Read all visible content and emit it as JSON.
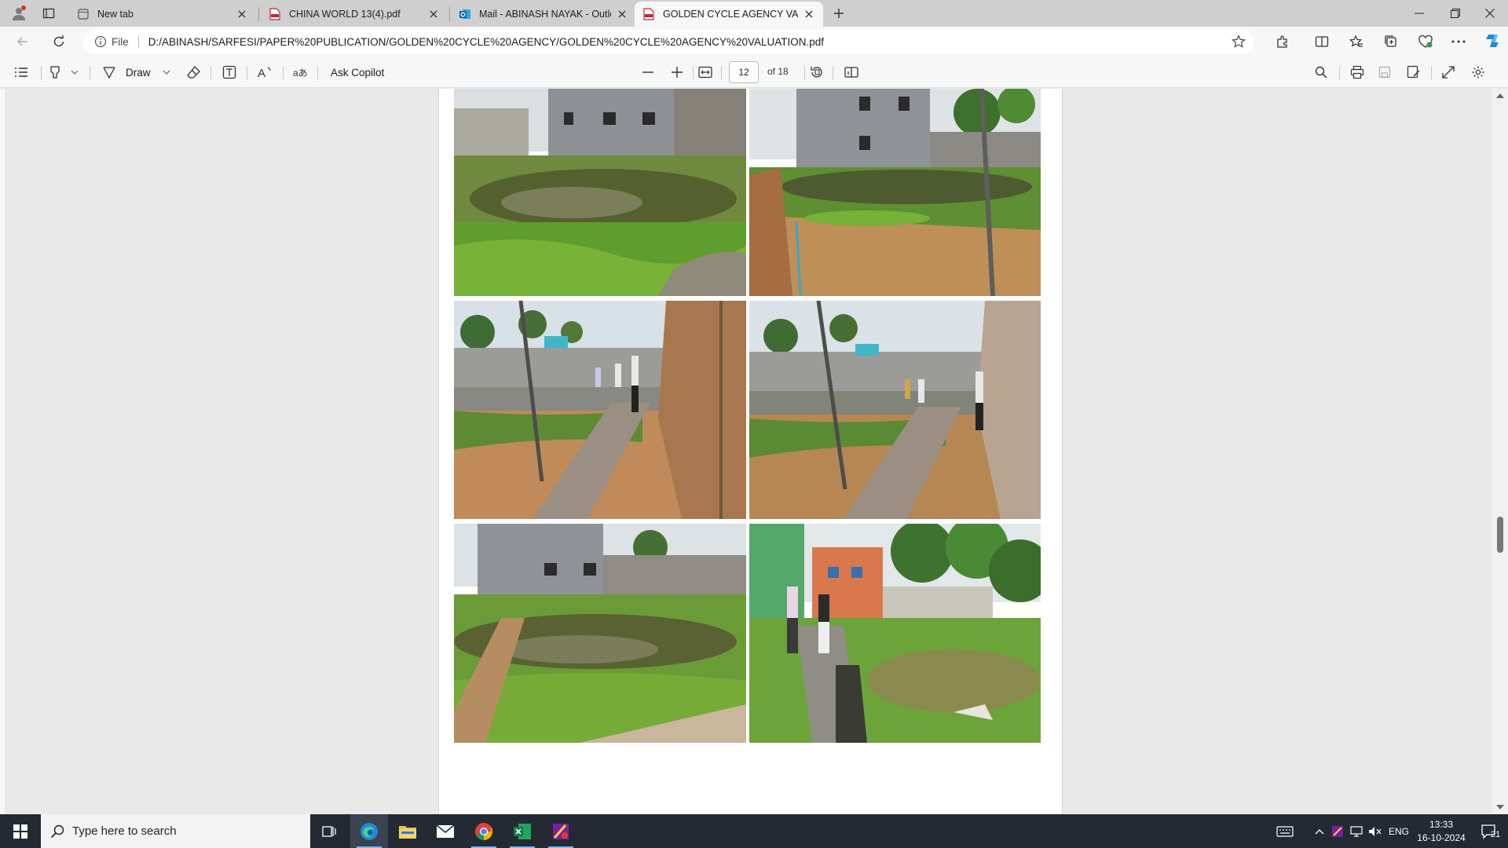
{
  "browser": {
    "tabs": [
      {
        "title": "New tab",
        "icon": "newtab-page-icon",
        "active": false
      },
      {
        "title": "CHINA WORLD 13(4).pdf",
        "icon": "pdf-file-icon",
        "active": false
      },
      {
        "title": "Mail - ABINASH NAYAK - Outlook",
        "icon": "outlook-icon",
        "active": false
      },
      {
        "title": "GOLDEN CYCLE AGENCY VALUATI",
        "icon": "pdf-file-icon",
        "active": true
      }
    ],
    "address": {
      "scheme": "File",
      "url": "D:/ABINASH/SARFESI/PAPER%20PUBLICATION/GOLDEN%20CYCLE%20AGENCY/GOLDEN%20CYCLE%20AGENCY%20VALUATION.pdf"
    }
  },
  "pdf_toolbar": {
    "draw_label": "Draw",
    "copilot_label": "Ask Copilot",
    "current_page": "12",
    "page_count_label": "of 18"
  },
  "document": {
    "photos": [
      {
        "id": "site-photo-1",
        "scene": "two-storey building behind waterlogged grassy plot"
      },
      {
        "id": "site-photo-2",
        "scene": "building and pole over muddy plot with grass"
      },
      {
        "id": "site-photo-3",
        "scene": "paved path beside wall, people standing, palm trees"
      },
      {
        "id": "site-photo-4",
        "scene": "paved path beside wall, people standing, pole in front"
      },
      {
        "id": "site-photo-5",
        "scene": "building behind waterlogged plot with grass"
      },
      {
        "id": "site-photo-6",
        "scene": "two men near drain beside orange house and palms"
      }
    ]
  },
  "taskbar": {
    "search_placeholder": "Type here to search",
    "apps": [
      "task-view",
      "edge",
      "file-explorer",
      "mail",
      "chrome",
      "excel",
      "paint"
    ],
    "tray": {
      "language": "ENG",
      "time": "13:33",
      "date": "16-10-2024",
      "notifications": "21"
    }
  },
  "colors": {
    "tabstrip": "#cfcfcf",
    "toolbar": "#f7f7f7",
    "viewer_bg": "#e9e9e9",
    "taskbar": "#242a33",
    "edge_blue": "#1f8ad6"
  }
}
